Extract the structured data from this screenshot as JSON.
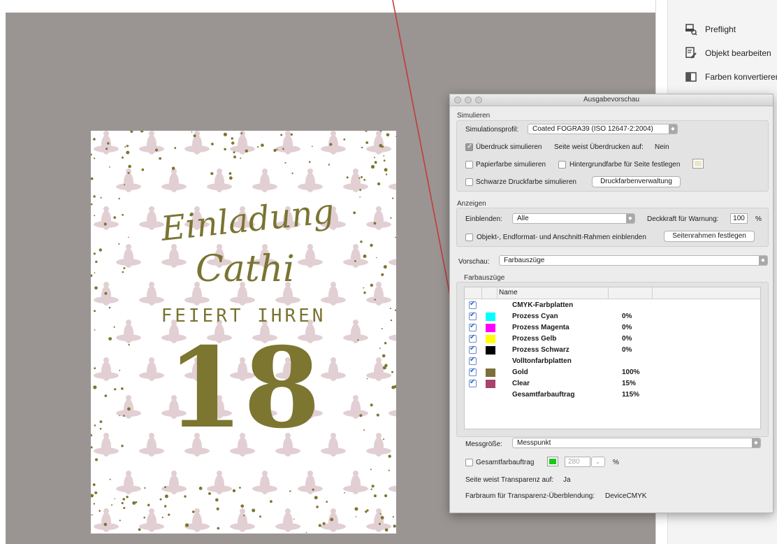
{
  "right_panel": {
    "items": [
      {
        "label": "Preflight",
        "icon": "preflight-icon"
      },
      {
        "label": "Objekt bearbeiten",
        "icon": "edit-object-icon"
      },
      {
        "label": "Farben konvertieren",
        "icon": "convert-colors-icon"
      }
    ]
  },
  "document": {
    "title_script": "Einladung",
    "name_script": "Cathi",
    "subtitle": "FEIERT IHREN",
    "number": "18",
    "colors": {
      "olive": "#7c7630",
      "pattern": "#e2cfd3"
    }
  },
  "dialog": {
    "title": "Ausgabevorschau",
    "simulate": {
      "section_label": "Simulieren",
      "profile_label": "Simulationsprofil:",
      "profile_value": "Coated FOGRA39 (ISO 12647-2:2004)",
      "overprint_label": "Überdruck simulieren",
      "overprint_checked": true,
      "page_overprint_text": "Seite weist Überdrucken auf:",
      "page_overprint_value": "Nein",
      "paper_color_label": "Papierfarbe simulieren",
      "bg_color_label": "Hintergrundfarbe für Seite festlegen",
      "black_ink_label": "Schwarze Druckfarbe simulieren",
      "ink_manager_button": "Druckfarbenverwaltung"
    },
    "show": {
      "section_label": "Anzeigen",
      "show_label": "Einblenden:",
      "show_value": "Alle",
      "opacity_label": "Deckkraft für Warnung:",
      "opacity_value": "100",
      "opacity_unit": "%",
      "frames_label": "Objekt-, Endformat- und Anschnitt-Rahmen einblenden",
      "set_frames_button": "Seitenrahmen festlegen"
    },
    "preview": {
      "label": "Vorschau:",
      "value": "Farbauszüge"
    },
    "separations": {
      "section_label": "Farbauszüge",
      "column_name": "Name",
      "rows": [
        {
          "name": "CMYK-Farbplatten",
          "value": "",
          "color": ""
        },
        {
          "name": "Prozess Cyan",
          "value": "0%",
          "color": "#00ffff"
        },
        {
          "name": "Prozess Magenta",
          "value": "0%",
          "color": "#ff00ff"
        },
        {
          "name": "Prozess Gelb",
          "value": "0%",
          "color": "#ffff00"
        },
        {
          "name": "Prozess Schwarz",
          "value": "0%",
          "color": "#000000"
        },
        {
          "name": "Volltonfarbplatten",
          "value": "",
          "color": ""
        },
        {
          "name": "Gold",
          "value": "100%",
          "color": "#7c6f3a"
        },
        {
          "name": "Clear",
          "value": "15%",
          "color": "#a8436b"
        },
        {
          "name": "Gesamtfarbauftrag",
          "value": "115%",
          "color": ""
        }
      ]
    },
    "measure": {
      "label": "Messgröße:",
      "value": "Messpunkt"
    },
    "total_coverage": {
      "label": "Gesamtfarbauftrag",
      "color": "#17c817",
      "value": "280",
      "unit": "%"
    },
    "transparency": {
      "label": "Seite weist Transparenz auf:",
      "value": "Ja"
    },
    "blend_space": {
      "label": "Farbraum für Transparenz-Überblendung:",
      "value": "DeviceCMYK"
    }
  }
}
